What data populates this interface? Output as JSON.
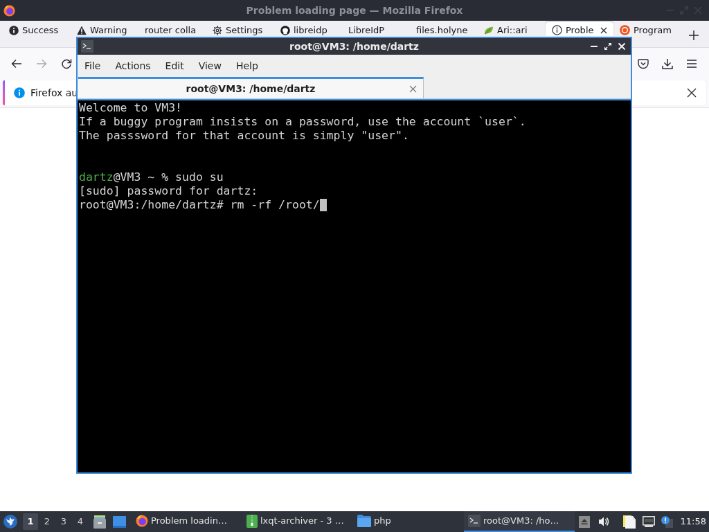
{
  "firefox": {
    "window_title": "Problem loading page — Mozilla Firefox",
    "tabs": [
      {
        "label": "Success",
        "selected": false
      },
      {
        "label": "Warning",
        "selected": false
      },
      {
        "label": "router colla",
        "selected": false
      },
      {
        "label": "Settings",
        "selected": false
      },
      {
        "label": "libreidp",
        "selected": false
      },
      {
        "label": "LibreIdP",
        "selected": false
      },
      {
        "label": "files.holyne",
        "selected": false
      },
      {
        "label": "Ari::ari",
        "selected": false
      },
      {
        "label": "Proble",
        "selected": true
      },
      {
        "label": "Program",
        "selected": false
      }
    ],
    "notification": {
      "text": "Firefox au"
    }
  },
  "terminal": {
    "window_title": "root@VM3: /home/dartz",
    "menu": [
      "File",
      "Actions",
      "Edit",
      "View",
      "Help"
    ],
    "tabs": [
      {
        "label": "root@VM3: /home/dartz",
        "selected": true
      }
    ],
    "lines": [
      {
        "kind": "text",
        "cursor": false,
        "segments": [
          {
            "kind": "plain",
            "text": "Welcome to VM3!"
          }
        ]
      },
      {
        "kind": "text",
        "cursor": false,
        "segments": [
          {
            "kind": "plain",
            "text": "If a buggy program insists on a password, use the account `user`."
          }
        ]
      },
      {
        "kind": "text",
        "cursor": false,
        "segments": [
          {
            "kind": "plain",
            "text": "The passsword for that account is simply \"user\"."
          }
        ]
      },
      {
        "kind": "blank"
      },
      {
        "kind": "blank"
      },
      {
        "kind": "text",
        "cursor": false,
        "segments": [
          {
            "kind": "user",
            "text": "dartz"
          },
          {
            "kind": "plain",
            "text": "@VM3 ~ % sudo su"
          }
        ]
      },
      {
        "kind": "text",
        "cursor": false,
        "segments": [
          {
            "kind": "plain",
            "text": "[sudo] password for dartz:"
          }
        ]
      },
      {
        "kind": "text",
        "cursor": true,
        "segments": [
          {
            "kind": "plain",
            "text": "root@VM3:/home/dartz# rm -rf /root/"
          }
        ]
      }
    ]
  },
  "taskbar": {
    "workspaces": [
      {
        "label": "1",
        "selected": true
      },
      {
        "label": "2",
        "selected": false
      },
      {
        "label": "3",
        "selected": false
      },
      {
        "label": "4",
        "selected": false
      }
    ],
    "tasks": [
      {
        "label": "Problem loadin…",
        "selected": false
      },
      {
        "label": "lxqt-archiver - 3 …",
        "selected": false
      },
      {
        "label": "php",
        "selected": false
      },
      {
        "label": "root@VM3: /ho…",
        "selected": true
      }
    ],
    "clock": "11:58"
  }
}
